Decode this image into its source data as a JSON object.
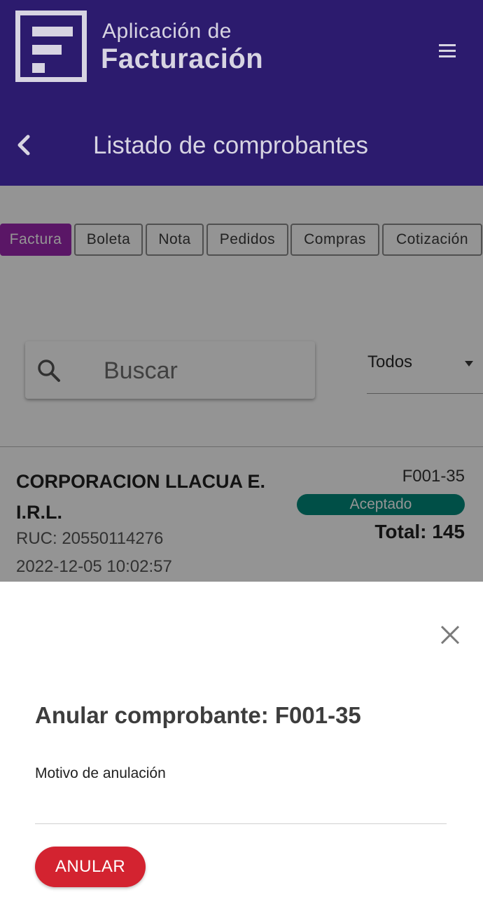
{
  "app": {
    "title_line1": "Aplicación de",
    "title_line2": "Facturación"
  },
  "header": {
    "page_title": "Listado de comprobantes"
  },
  "tabs": [
    {
      "label": "Factura",
      "active": true
    },
    {
      "label": "Boleta",
      "active": false
    },
    {
      "label": "Nota",
      "active": false
    },
    {
      "label": "Pedidos",
      "active": false
    },
    {
      "label": "Compras",
      "active": false
    },
    {
      "label": "Cotización",
      "active": false
    }
  ],
  "search": {
    "placeholder": "Buscar",
    "value": ""
  },
  "filter": {
    "selected": "Todos"
  },
  "list": {
    "items": [
      {
        "company": "CORPORACION LLACUA E. I.R.L.",
        "ruc": "RUC: 20550114276",
        "date": "2022-12-05 10:02:57",
        "number": "F001-35",
        "status": "Aceptado",
        "total": "Total: 145"
      }
    ]
  },
  "dialog": {
    "title": "Anular comprobante: F001-35",
    "field_label": "Motivo de anulación",
    "reason_value": "",
    "button_label": "ANULAR"
  },
  "icons": {
    "logo": "logo-f-icon",
    "menu": "hamburger-menu-icon",
    "back": "chevron-left-icon",
    "search": "search-icon",
    "dropdown": "caret-down-icon",
    "close": "close-icon"
  },
  "colors": {
    "header_bg": "#2c1b6e",
    "tab_active": "#9c27b0",
    "status_accepted": "#00897b",
    "danger_button": "#d32330"
  }
}
